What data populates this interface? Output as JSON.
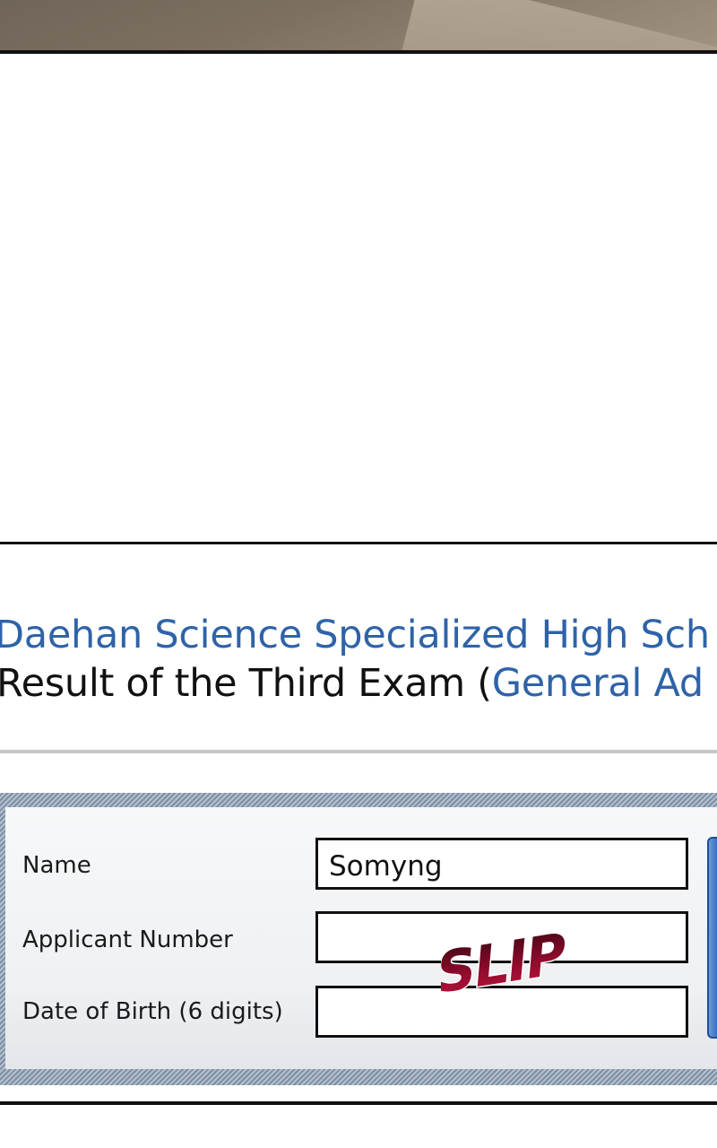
{
  "header": {
    "school_name": "Daehan Science Specialized High Sch",
    "result_prefix": "Result of the Third Exam (",
    "result_accent": "General Ad"
  },
  "form": {
    "name_label": "Name",
    "name_value": "Somyng",
    "applicant_label": "Applicant Number",
    "applicant_value": "",
    "dob_label": "Date of Birth (6 digits)",
    "dob_value": ""
  },
  "sfx": {
    "text": "SLIP"
  },
  "colors": {
    "accent_blue": "#2f63a8",
    "sfx_red": "#8f0b2c",
    "submit_blue": "#3d73c4"
  }
}
